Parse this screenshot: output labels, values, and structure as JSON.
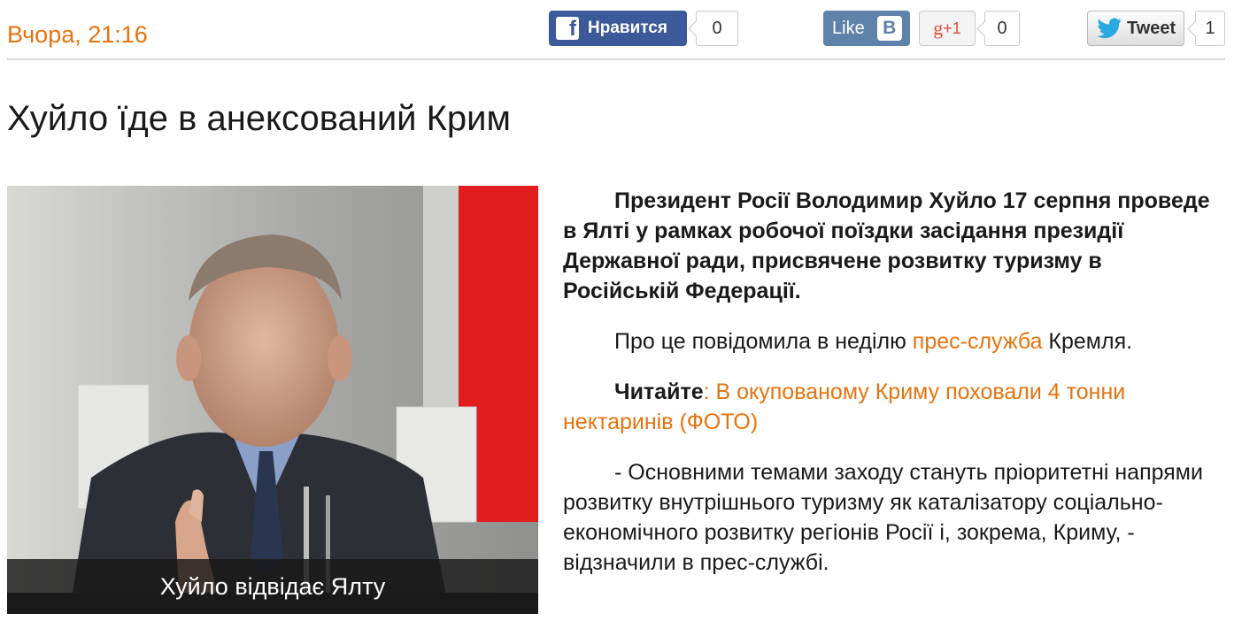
{
  "meta": {
    "date": "Вчора, 21:16"
  },
  "share": {
    "facebook": {
      "label": "Нравится",
      "count": "0",
      "icon": "facebook-icon"
    },
    "vk": {
      "label": "Like",
      "logo": "B",
      "icon": "vk-icon"
    },
    "gplus": {
      "label_g": "g",
      "label_plus": "+1",
      "count": "0",
      "icon": "google-plus-icon"
    },
    "twitter": {
      "label": "Tweet",
      "count": "1",
      "icon": "twitter-bird-icon"
    }
  },
  "article": {
    "title": "Хуйло їде в анексований Крим",
    "image_caption": "Хуйло відвідає Ялту",
    "lead": "Президент Росії Володимир Хуйло 17 серпня проведе в Ялті у рамках робочої поїздки засідання президії Державної ради, присвячене розвитку туризму в Російській Федерації.",
    "p1_before": "Про це повідомила в неділю ",
    "p1_link": "прес-служба",
    "p1_after": " Кремля.",
    "read_label": "Читайте",
    "read_sep": ": ",
    "read_link": "В окупованому Криму поховали 4 тонни нектаринів (ФОТО)",
    "p2": "- Основними темами заходу стануть пріоритетні напрями розвитку внутрішнього туризму як каталізатору соціально-економічного розвитку регіонів Росії і, зокрема, Криму, - відзначили в прес-службі."
  },
  "colors": {
    "accent": "#e8720c",
    "facebook": "#3c5a99",
    "vk": "#5f82ab",
    "gplus": "#dd4b39",
    "twitter": "#2aa9e0"
  }
}
